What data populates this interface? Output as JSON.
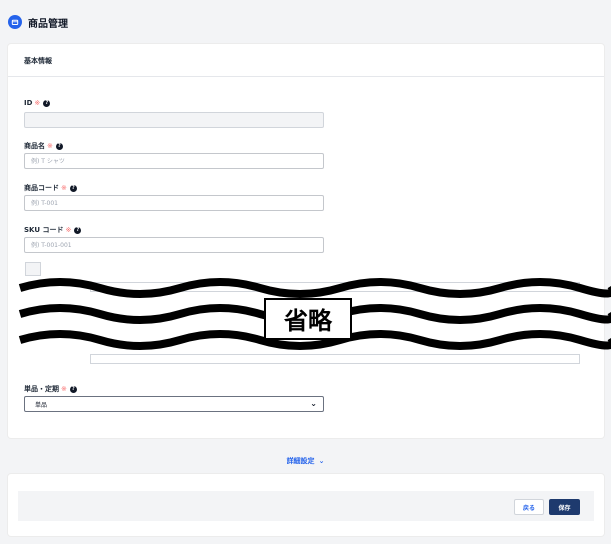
{
  "header": {
    "title": "商品管理",
    "icon": "product-icon"
  },
  "card": {
    "title": "基本情報"
  },
  "required_mark": "※",
  "help_mark": "?",
  "fields": {
    "id": {
      "label": "ID",
      "value": "",
      "placeholder": ""
    },
    "name": {
      "label": "商品名",
      "placeholder": "例) T シャツ"
    },
    "code": {
      "label": "商品コード",
      "placeholder": "例) T-001"
    },
    "sku": {
      "label": "SKU コード",
      "placeholder": "例) T-001-001"
    },
    "type": {
      "label": "単品・定期",
      "value": "単品"
    }
  },
  "omitted": {
    "label": "省略"
  },
  "detail_toggle": {
    "label": "詳細設定"
  },
  "footer": {
    "back_label": "戻る",
    "save_label": "保存"
  },
  "colors": {
    "accent": "#2563eb",
    "save_button": "#1e3a6e",
    "required": "#f87171"
  }
}
